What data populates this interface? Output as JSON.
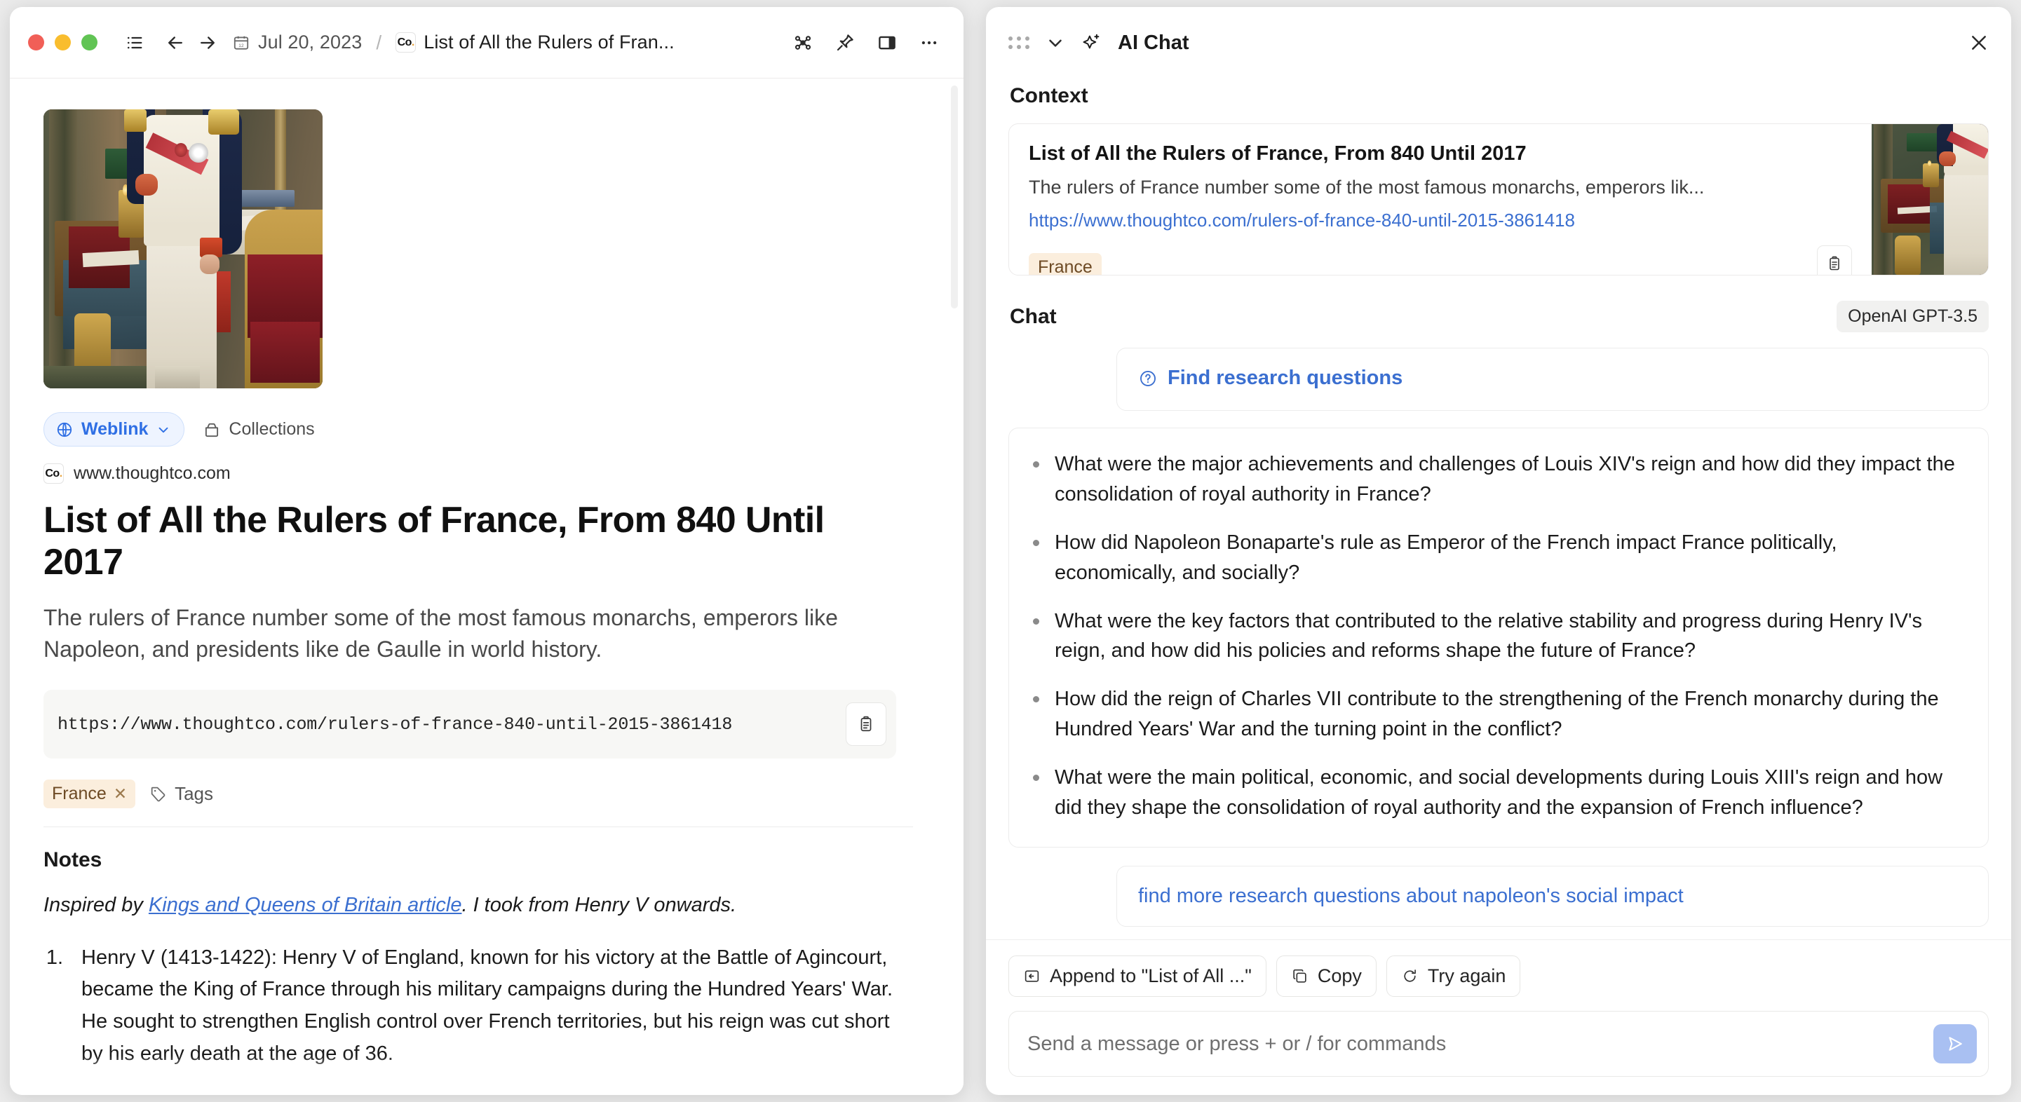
{
  "window": {
    "breadcrumb": {
      "date": "Jul 20, 2023",
      "separator": "/",
      "doc_title": "List of All the Rulers of Fran...",
      "favicon_text": "Co"
    },
    "toolbar": {
      "list_icon": "list-icon",
      "back_icon": "back-arrow-icon",
      "forward_icon": "forward-arrow-icon",
      "calendar_icon": "calendar-icon",
      "graph_icon": "graph-network-icon",
      "pin_icon": "pin-icon",
      "panel_icon": "split-panel-icon",
      "more_icon": "more-ellipsis-icon"
    }
  },
  "document": {
    "hero_image_alt": "Napoleon in His Study painting",
    "type_pill": "Weblink",
    "collections_label": "Collections",
    "domain": "www.thoughtco.com",
    "title": "List of All the Rulers of France, From 840 Until 2017",
    "description": "The rulers of France number some of the most famous monarchs, emperors like Napoleon, and presidents like de Gaulle in world history.",
    "url": "https://www.thoughtco.com/rulers-of-france-840-until-2015-3861418",
    "tags": [
      "France"
    ],
    "tags_add_label": "Tags",
    "notes_heading": "Notes",
    "note_intro_prefix": "Inspired by ",
    "note_intro_link": "Kings and Queens of Britain article",
    "note_intro_suffix": ". I took from Henry V onwards.",
    "note_items": [
      {
        "num": "1.",
        "text": "Henry V (1413-1422): Henry V of England, known for his victory at the Battle of Agincourt, became the King of France through his military campaigns during the Hundred Years' War. He sought to strengthen English control over French territories, but his reign was cut short by his early death at the age of 36."
      }
    ]
  },
  "chat": {
    "panel_title": "AI Chat",
    "grip_icon": "drag-grip-icon",
    "collapse_icon": "chevron-down-icon",
    "sparkle_icon": "sparkle-icon",
    "close_icon": "close-icon",
    "context_label": "Context",
    "context_card": {
      "title": "List of All the Rulers of France, From 840 Until 2017",
      "description": "The rulers of France number some of the most famous monarchs, emperors lik...",
      "url": "https://www.thoughtco.com/rulers-of-france-840-until-2015-3861418",
      "tag": "France",
      "copy_icon": "clipboard-icon"
    },
    "chat_label": "Chat",
    "model_badge": "OpenAI GPT-3.5",
    "user_prompt": "Find research questions",
    "user_prompt_icon": "question-circle-icon",
    "answer_questions": [
      "What were the major achievements and challenges of Louis XIV's reign and how did they impact the consolidation of royal authority in France?",
      "How did Napoleon Bonaparte's rule as Emperor of the French impact France politically, economically, and socially?",
      "What were the key factors that contributed to the relative stability and progress during Henry IV's reign, and how did his policies and reforms shape the future of France?",
      "How did the reign of Charles VII contribute to the strengthening of the French monarchy during the Hundred Years' War and the turning point in the conflict?",
      "What were the main political, economic, and social developments during Louis XIII's reign and how did they shape the consolidation of royal authority and the expansion of French influence?"
    ],
    "followup": "find more research questions about napoleon's social impact",
    "actions": [
      {
        "label": "Append to \"List of All ...\"",
        "icon": "append-icon"
      },
      {
        "label": "Copy",
        "icon": "copy-icon"
      },
      {
        "label": "Try again",
        "icon": "refresh-icon"
      }
    ],
    "composer": {
      "placeholder": "Send a message or press + or / for commands",
      "value": "",
      "send_icon": "send-icon"
    }
  },
  "colors": {
    "accent_blue": "#3b6fd0",
    "pill_blue": "#2f6fe4",
    "tag_bg": "#fbeedd",
    "tag_text": "#6d4a24",
    "send_button": "#a9c0f2"
  }
}
